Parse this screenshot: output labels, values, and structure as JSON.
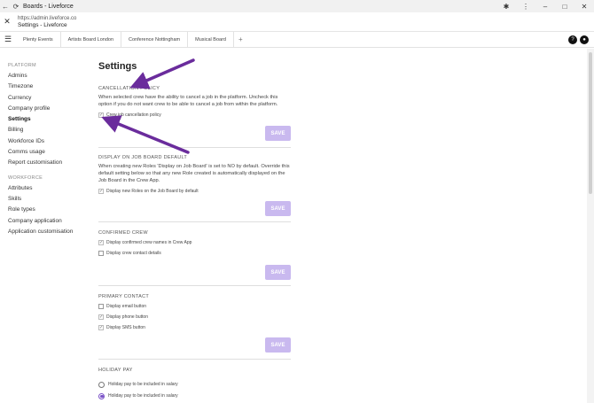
{
  "window": {
    "title": "Boards - Liveforce",
    "url": "https://admin.liveforce.co",
    "page_title": "Settings - Liveforce"
  },
  "tabs": [
    {
      "label": "Plenty Events"
    },
    {
      "label": "Artists Board London"
    },
    {
      "label": "Conference Nottingham"
    },
    {
      "label": "Musical Board"
    }
  ],
  "header_icons": {
    "help": "?",
    "account": "●"
  },
  "sidebar": {
    "platform_heading": "PLATFORM",
    "platform_items": [
      {
        "label": "Admins"
      },
      {
        "label": "Timezone"
      },
      {
        "label": "Currency"
      },
      {
        "label": "Company profile"
      },
      {
        "label": "Settings",
        "active": true
      },
      {
        "label": "Billing"
      },
      {
        "label": "Workforce IDs"
      },
      {
        "label": "Comms usage"
      },
      {
        "label": "Report customisation"
      }
    ],
    "workforce_heading": "WORKFORCE",
    "workforce_items": [
      {
        "label": "Attributes"
      },
      {
        "label": "Skills"
      },
      {
        "label": "Role types"
      },
      {
        "label": "Company application"
      },
      {
        "label": "Application customisation"
      }
    ]
  },
  "main": {
    "title": "Settings",
    "save_label": "SAVE",
    "cancellation": {
      "title": "CANCELLATION POLICY",
      "desc": "When selected crew have the ability to cancel a job in the platform. Uncheck this option if you do not want crew to be able to cancel a job from within the platform.",
      "option": "Crew job cancellation policy"
    },
    "display_on_board": {
      "title": "DISPLAY ON JOB BOARD DEFAULT",
      "desc": "When creating new Roles 'Display on Job Board' is set to NO by default. Override this default setting below so that any new Role created is automatically displayed on the Job Board in the Crew App.",
      "option": "Display new Roles on the Job Board by default"
    },
    "confirmed_crew": {
      "title": "CONFIRMED CREW",
      "option1": "Display confirmed crew names in Crew App",
      "option2": "Display crew contact details"
    },
    "primary_contact": {
      "title": "PRIMARY CONTACT",
      "option1": "Display email button",
      "option2": "Display phone button",
      "option3": "Display SMS button"
    },
    "holiday_pay": {
      "title": "HOLIDAY PAY",
      "option1": "Holiday pay to be included in salary",
      "option2": "Holiday pay to be included in salary"
    }
  },
  "colors": {
    "accent": "#7a52c7",
    "save_bg": "#c9b9ef",
    "arrow": "#6a2c9c"
  }
}
